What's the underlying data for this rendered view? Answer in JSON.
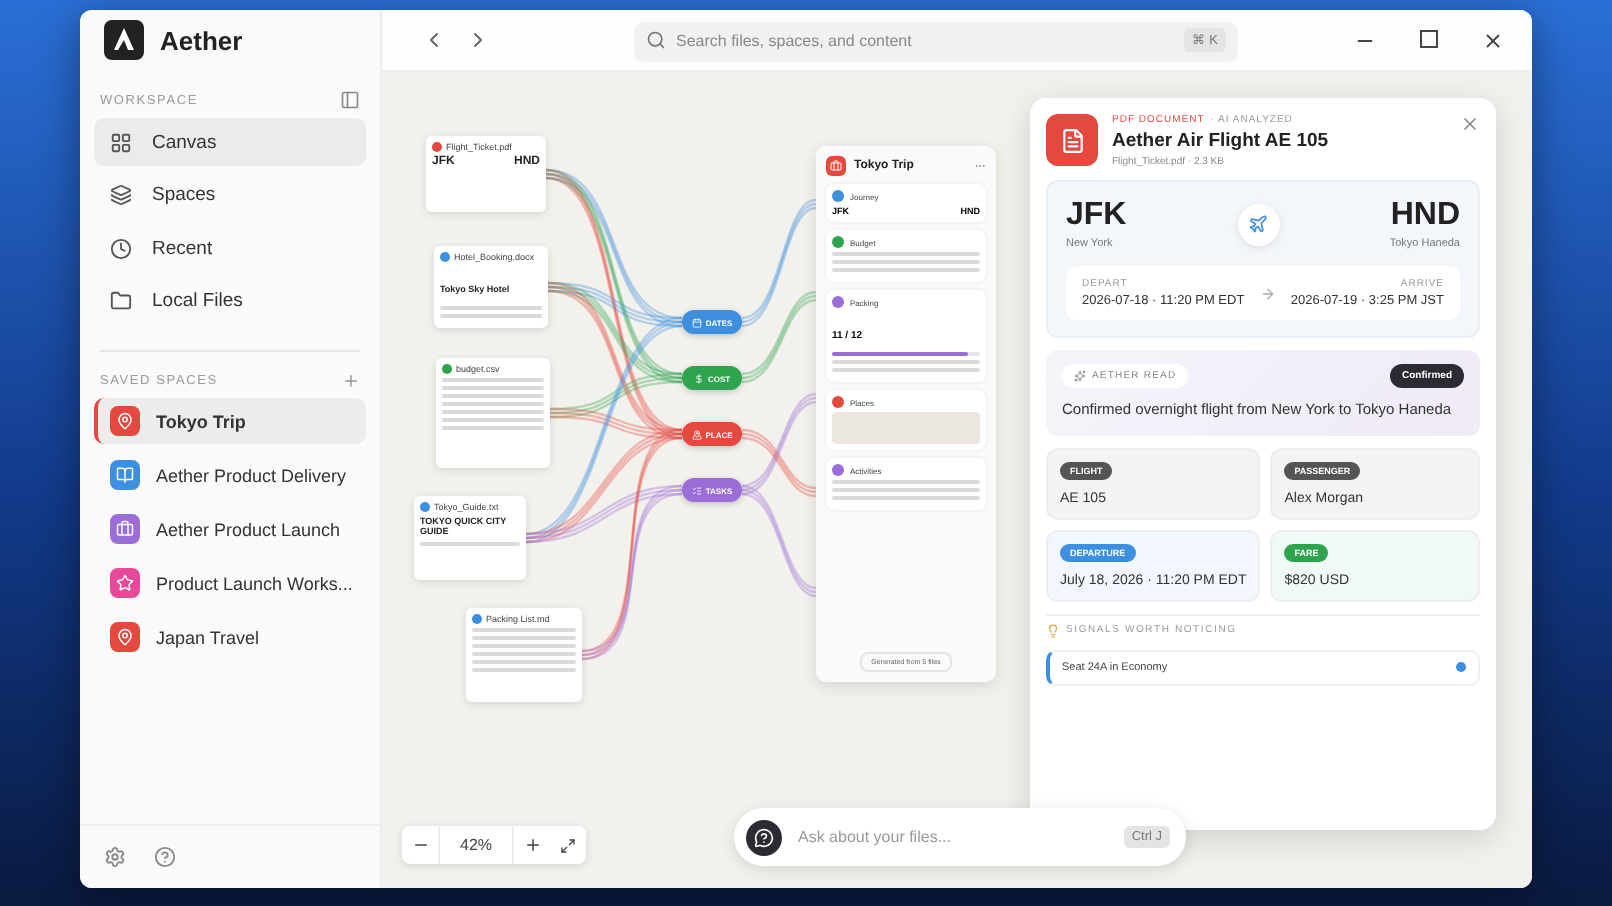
{
  "app": {
    "name": "Aether"
  },
  "search": {
    "placeholder": "Search files, spaces, and content",
    "shortcut": "⌘ K"
  },
  "sidebar": {
    "workspace_label": "WORKSPACE",
    "saved_label": "SAVED SPACES",
    "nav": [
      {
        "label": "Canvas",
        "selected": true
      },
      {
        "label": "Spaces",
        "selected": false
      },
      {
        "label": "Recent",
        "selected": false
      },
      {
        "label": "Local Files",
        "selected": false
      }
    ],
    "spaces": [
      {
        "label": "Tokyo Trip",
        "color": "#e5483f",
        "selected": true
      },
      {
        "label": "Aether Product Delivery",
        "color": "#3d8fe0",
        "selected": false
      },
      {
        "label": "Aether Product Launch",
        "color": "#9b6dd6",
        "selected": false
      },
      {
        "label": "Product Launch Works...",
        "color": "#e8489a",
        "selected": false
      },
      {
        "label": "Japan Travel",
        "color": "#e5483f",
        "selected": false
      }
    ]
  },
  "canvas": {
    "files": [
      {
        "kind": "flight",
        "name": "Flight_Ticket.pdf",
        "color": "#e5483f",
        "from": "JFK",
        "to": "HND"
      },
      {
        "kind": "doc",
        "name": "Hotel_Booking.docx",
        "color": "#3d8fe0",
        "heading": "Tokyo Sky Hotel"
      },
      {
        "kind": "table",
        "name": "budget.csv",
        "color": "#2ea44f"
      },
      {
        "kind": "guide",
        "name": "Tokyo_Guide.txt",
        "color": "#3d8fe0",
        "heading": "TOKYO QUICK CITY GUIDE"
      },
      {
        "kind": "list",
        "name": "Packing List.md",
        "color": "#3d8fe0"
      }
    ],
    "tags": [
      {
        "label": "DATES",
        "color": "#3d8fe0"
      },
      {
        "label": "COST",
        "color": "#2ea44f"
      },
      {
        "label": "PLACE",
        "color": "#e5483f"
      },
      {
        "label": "TASKS",
        "color": "#9b6dd6"
      }
    ],
    "doc": {
      "title": "Tokyo Trip",
      "footer": "Generated from 5 files",
      "sections": [
        {
          "kind": "journey",
          "title": "Journey",
          "color": "#3d8fe0",
          "from": "JFK",
          "to": "HND"
        },
        {
          "kind": "budget",
          "title": "Budget",
          "color": "#2ea44f"
        },
        {
          "kind": "packing",
          "title": "Packing",
          "color": "#9b6dd6",
          "count": "11 / 12",
          "level": 0.92
        },
        {
          "kind": "places",
          "title": "Places",
          "color": "#e5483f"
        },
        {
          "kind": "activities",
          "title": "Activities",
          "color": "#9b6dd6"
        }
      ]
    },
    "zoom": "42%"
  },
  "detail": {
    "type": "PDF DOCUMENT",
    "badge": "· AI ANALYZED",
    "title": "Aether Air Flight AE 105",
    "meta": "Flight_Ticket.pdf · 2.3 KB",
    "from": {
      "code": "JFK",
      "city": "New York"
    },
    "to": {
      "code": "HND",
      "city": "Tokyo Haneda"
    },
    "depart": {
      "label": "DEPART",
      "value": "2026-07-18 · 11:20 PM EDT"
    },
    "arrive": {
      "label": "ARRIVE",
      "value": "2026-07-19 · 3:25 PM JST"
    },
    "read_label": "AETHER READ",
    "status": "Confirmed",
    "summary": "Confirmed overnight flight from New York to Tokyo Haneda",
    "facts": [
      {
        "label": "FLIGHT",
        "value": "AE 105",
        "color": "#555555"
      },
      {
        "label": "PASSENGER",
        "value": "Alex Morgan",
        "color": "#555555"
      },
      {
        "label": "DEPARTURE",
        "value": "July 18, 2026 · 11:20 PM EDT",
        "color": "#3d8fe0"
      },
      {
        "label": "FARE",
        "value": "$820 USD",
        "color": "#2ea44f"
      }
    ],
    "signals_label": "SIGNALS WORTH NOTICING",
    "signals": [
      "Seat 24A in Economy"
    ]
  },
  "chat": {
    "placeholder": "Ask about your files...",
    "shortcut": "Ctrl J"
  }
}
